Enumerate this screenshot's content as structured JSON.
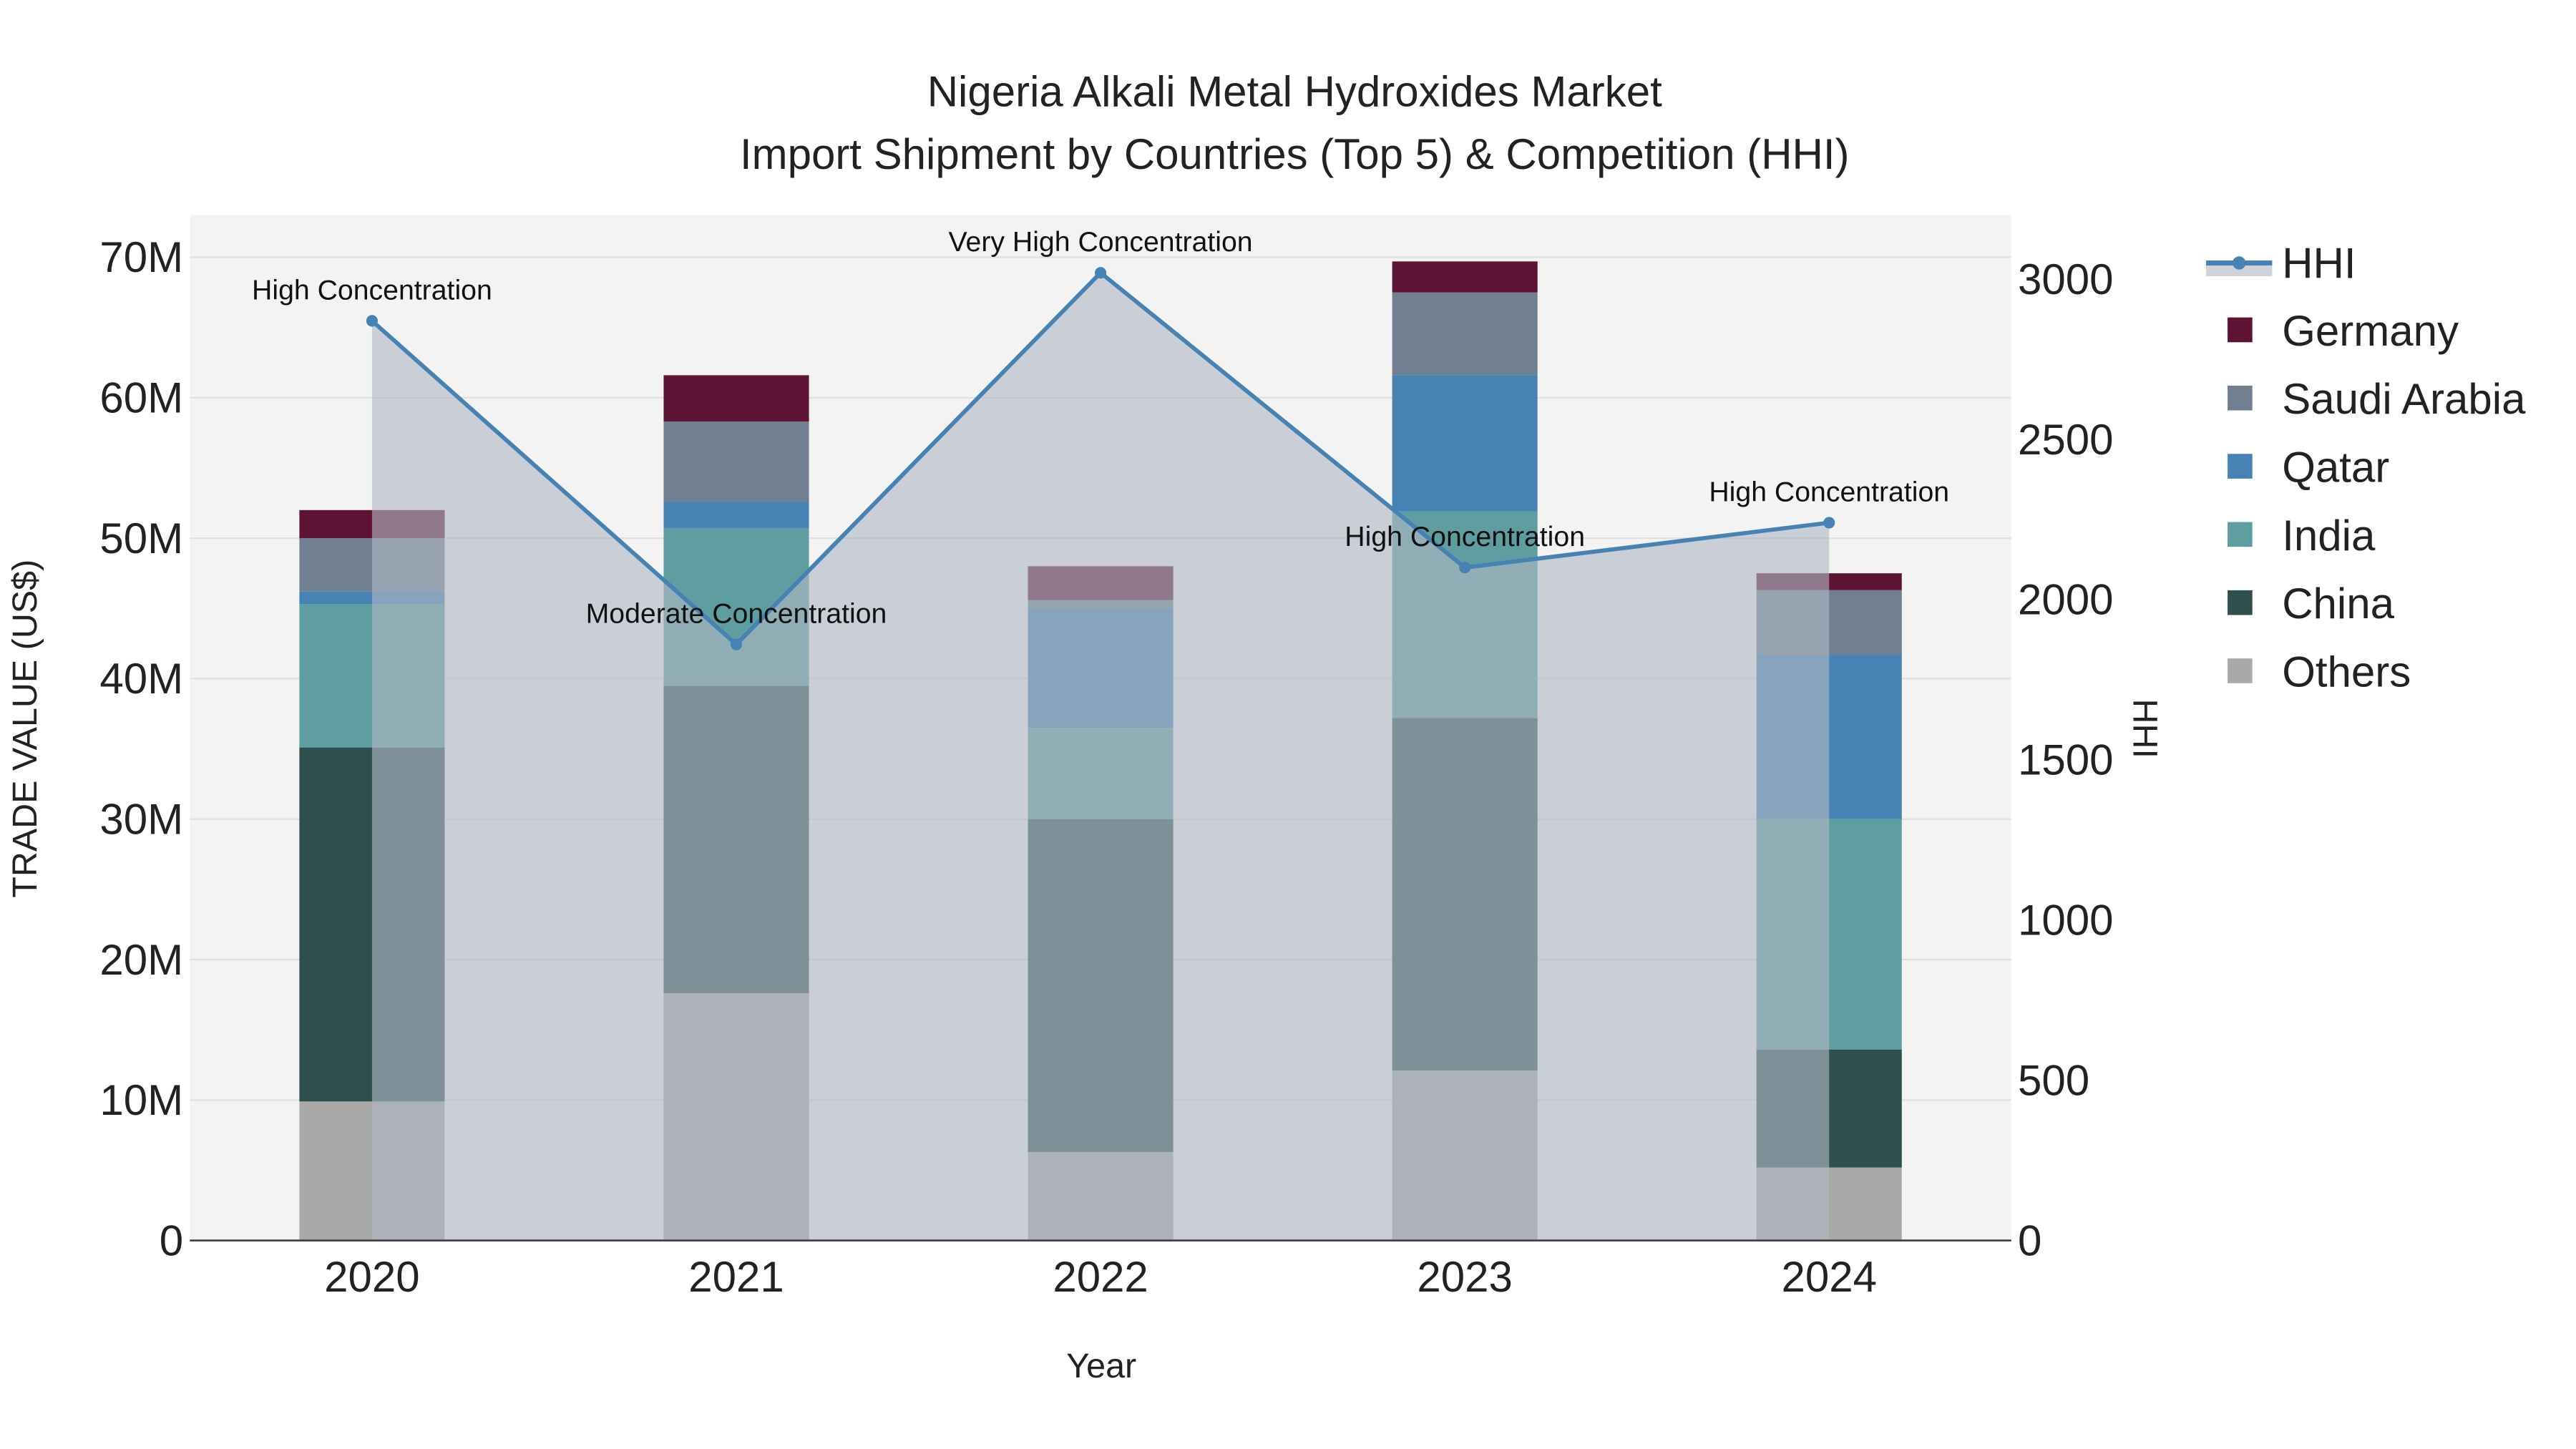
{
  "chart_data": {
    "type": "bar",
    "title": "Nigeria Alkali Metal Hydroxides Market",
    "subtitle": "Import Shipment by Countries (Top 5) & Competition (HHI)",
    "xlabel": "Year",
    "ylabel": "TRADE VALUE (US$)",
    "y2label": "HHI",
    "categories": [
      "2020",
      "2021",
      "2022",
      "2023",
      "2024"
    ],
    "ylim": [
      0,
      73000000
    ],
    "y2lim": [
      0,
      3200
    ],
    "yticks": [
      0,
      10000000,
      20000000,
      30000000,
      40000000,
      50000000,
      60000000,
      70000000
    ],
    "ytick_labels": [
      "0",
      "10M",
      "20M",
      "30M",
      "40M",
      "50M",
      "60M",
      "70M"
    ],
    "y2ticks": [
      0,
      500,
      1000,
      1500,
      2000,
      2500,
      3000
    ],
    "y2tick_labels": [
      "0",
      "500",
      "1000",
      "1500",
      "2000",
      "2500",
      "3000"
    ],
    "stacked": true,
    "series": [
      {
        "name": "Others",
        "color": "#a9a9a9",
        "values": [
          9900000,
          17600000,
          6300000,
          12100000,
          5200000
        ]
      },
      {
        "name": "China",
        "color": "#2f4f4f",
        "values": [
          25200000,
          21900000,
          23700000,
          25100000,
          8400000
        ]
      },
      {
        "name": "India",
        "color": "#5f9ea0",
        "values": [
          10200000,
          11200000,
          6500000,
          14700000,
          16400000
        ]
      },
      {
        "name": "Qatar",
        "color": "#4682b4",
        "values": [
          900000,
          1900000,
          8500000,
          9700000,
          11700000
        ]
      },
      {
        "name": "Saudi Arabia",
        "color": "#708090",
        "values": [
          3800000,
          5700000,
          600000,
          5900000,
          4600000
        ]
      },
      {
        "name": "Germany",
        "color": "#5e1234",
        "values": [
          2000000,
          3300000,
          2400000,
          2200000,
          1200000
        ]
      }
    ],
    "hhi": {
      "name": "HHI",
      "color": "#4682b4",
      "values": [
        2870,
        1860,
        3020,
        2100,
        2240
      ],
      "annotations": [
        "High Concentration",
        "Moderate Concentration",
        "Very High Concentration",
        "High Concentration",
        "High Concentration"
      ]
    },
    "legend_order": [
      "HHI",
      "Germany",
      "Saudi Arabia",
      "Qatar",
      "India",
      "China",
      "Others"
    ],
    "legend_position": "right",
    "grid": true
  }
}
